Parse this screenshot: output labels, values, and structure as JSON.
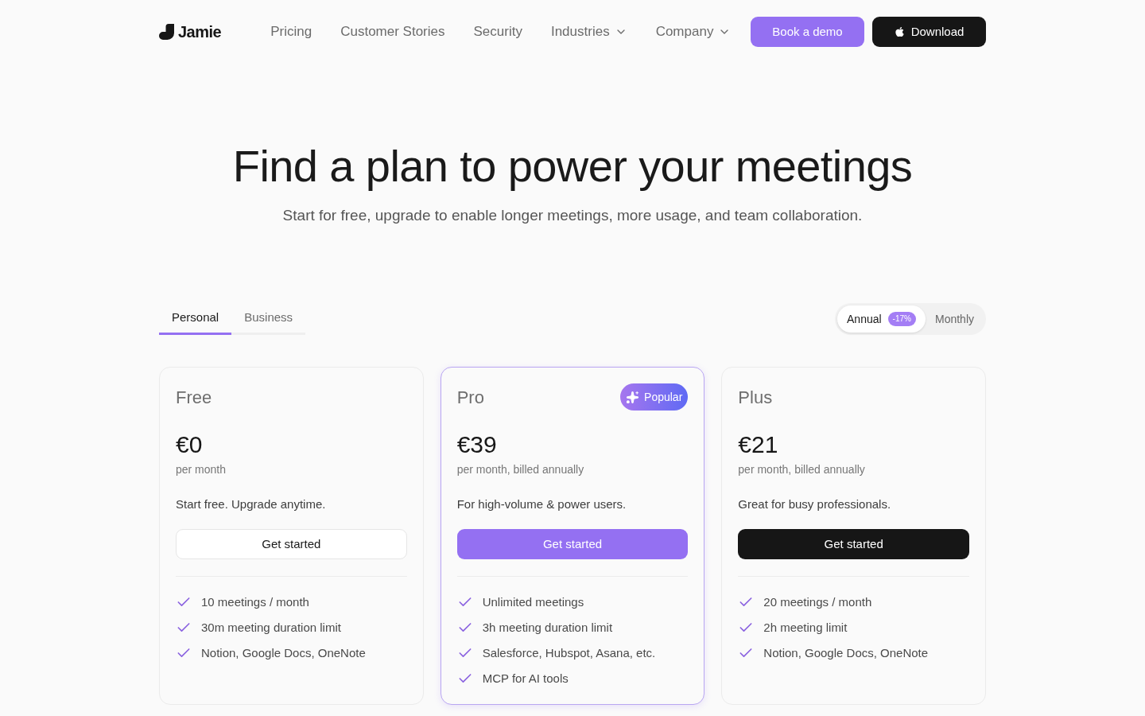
{
  "nav": {
    "logo": "Jamie",
    "links": [
      {
        "label": "Pricing",
        "dropdown": false
      },
      {
        "label": "Customer Stories",
        "dropdown": false
      },
      {
        "label": "Security",
        "dropdown": false
      },
      {
        "label": "Industries",
        "dropdown": true
      },
      {
        "label": "Company",
        "dropdown": true
      }
    ],
    "buttons": [
      {
        "label": "Book a demo",
        "kind": "demo"
      },
      {
        "label": "Download",
        "kind": "download"
      }
    ]
  },
  "hero": {
    "title": "Find a plan to power your meetings",
    "subtitle": "Start for free, upgrade to enable longer meetings, more usage, and team collaboration."
  },
  "plan_tabs": [
    {
      "label": "Personal",
      "selected": true
    },
    {
      "label": "Business",
      "selected": false
    }
  ],
  "billing_toggle": [
    {
      "label": "Annual",
      "selected": true,
      "badge": "-17%"
    },
    {
      "label": "Monthly",
      "selected": false
    }
  ],
  "plans": [
    {
      "name": "Free",
      "highlighted": false,
      "price": "€0",
      "period": "per month",
      "description": "Start free. Upgrade anytime.",
      "button": {
        "label": "Get started",
        "kind": "outline"
      },
      "features": [
        "10 meetings / month",
        "30m meeting duration limit",
        "Notion, Google Docs, OneNote"
      ]
    },
    {
      "name": "Pro",
      "highlighted": true,
      "badge": "Popular",
      "price": "€39",
      "period": "per month, billed annually",
      "description": "For high-volume & power users.",
      "button": {
        "label": "Get started",
        "kind": "primary"
      },
      "features": [
        "Unlimited meetings",
        "3h meeting duration limit",
        "Salesforce, Hubspot, Asana, etc.",
        "MCP for AI tools"
      ]
    },
    {
      "name": "Plus",
      "highlighted": false,
      "price": "€21",
      "period": "per month, billed annually",
      "description": "Great for busy professionals.",
      "button": {
        "label": "Get started",
        "kind": "dark"
      },
      "features": [
        "20 meetings / month",
        "2h meeting limit",
        "Notion, Google Docs, OneNote"
      ]
    }
  ]
}
